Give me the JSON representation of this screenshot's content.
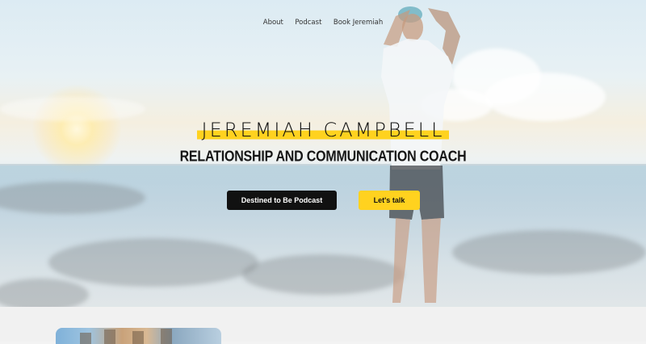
{
  "nav": {
    "about": "About",
    "podcast": "Podcast",
    "book": "Book Jeremiah"
  },
  "hero": {
    "name": "JEREMIAH CAMPBELL",
    "tagline": "RELATIONSHIP AND COMMUNICATION COACH",
    "primary_button": "Destined to Be Podcast",
    "secondary_button": "Let's talk"
  },
  "colors": {
    "accent": "#ffd21f",
    "dark": "#111111"
  }
}
